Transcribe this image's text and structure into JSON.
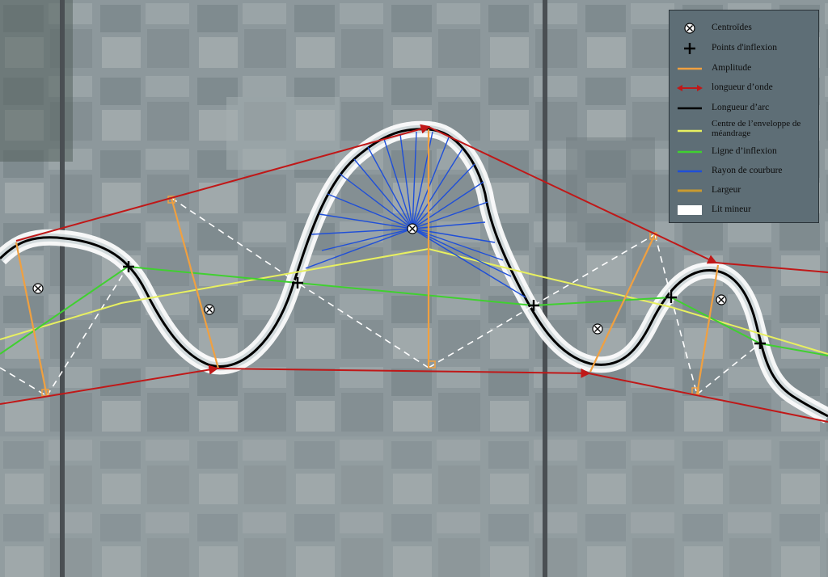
{
  "legend": {
    "items": [
      {
        "label": "Centroïdes",
        "symbol": "circled-x-icon"
      },
      {
        "label": "Points d'inflexion",
        "symbol": "plus-icon"
      },
      {
        "label": "Amplitude",
        "symbol": "line",
        "color": "#f0a040"
      },
      {
        "label": "longueur d’onde",
        "symbol": "double-arrow-icon",
        "color": "#c01818"
      },
      {
        "label": "Longueur d’arc",
        "symbol": "line",
        "color": "#000000"
      },
      {
        "label": "Centre de l’enveloppe de méandrage",
        "symbol": "line",
        "color": "#e8f060"
      },
      {
        "label": "Ligne d’inflexion",
        "symbol": "line",
        "color": "#40d030"
      },
      {
        "label": "Rayon de courbure",
        "symbol": "line",
        "color": "#1f4fd8"
      },
      {
        "label": "Largeur",
        "symbol": "line",
        "color": "#c89a30"
      },
      {
        "label": "Lit mineur",
        "symbol": "box",
        "color": "#ffffff"
      }
    ]
  },
  "colors": {
    "channel": "#ffffff",
    "arc": "#000000",
    "wavelength": "#c01818",
    "amplitude": "#f0a040",
    "envelope_center": "#e8f060",
    "inflection_line": "#40d030",
    "curvature_radius": "#1f4fd8",
    "dashed": "#ffffff"
  }
}
